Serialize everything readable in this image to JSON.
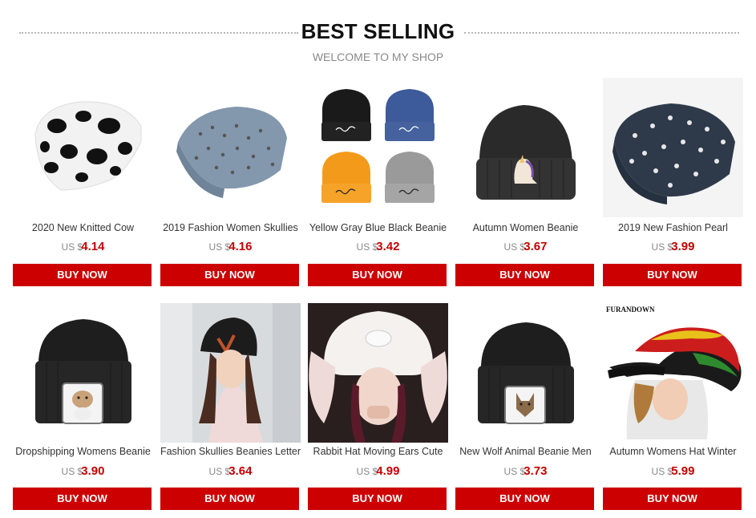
{
  "section": {
    "title": "BEST SELLING",
    "subtitle": "WELCOME TO MY SHOP"
  },
  "products": [
    {
      "name": "2020 New Knitted Cow",
      "currency": "US $",
      "price": "4.14",
      "button": "BUY NOW",
      "image": "cow-print-beanie"
    },
    {
      "name": "2019 Fashion Women Skullies",
      "currency": "US $",
      "price": "4.16",
      "button": "BUY NOW",
      "image": "studded-grey-beanie"
    },
    {
      "name": "Yellow Gray Blue Black Beanie",
      "currency": "US $",
      "price": "3.42",
      "button": "BUY NOW",
      "image": "four-color-beanies"
    },
    {
      "name": "Autumn Women Beanie",
      "currency": "US $",
      "price": "3.67",
      "button": "BUY NOW",
      "image": "black-unicorn-beanie"
    },
    {
      "name": "2019 New Fashion Pearl",
      "currency": "US $",
      "price": "3.99",
      "button": "BUY NOW",
      "image": "pearl-navy-beanie"
    },
    {
      "name": "Dropshipping Womens Beanie",
      "currency": "US $",
      "price": "3.90",
      "button": "BUY NOW",
      "image": "bulldog-patch-beanie"
    },
    {
      "name": "Fashion Skullies Beanies Letter",
      "currency": "US $",
      "price": "3.64",
      "button": "BUY NOW",
      "image": "letter-v-beanie-model"
    },
    {
      "name": "Rabbit Hat Moving Ears Cute",
      "currency": "US $",
      "price": "4.99",
      "button": "BUY NOW",
      "image": "rabbit-ears-hat-model"
    },
    {
      "name": "New Wolf Animal Beanie Men",
      "currency": "US $",
      "price": "3.73",
      "button": "BUY NOW",
      "image": "wolf-patch-beanie"
    },
    {
      "name": "Autumn Womens Hat Winter",
      "currency": "US $",
      "price": "5.99",
      "button": "BUY NOW",
      "image": "rasta-stripe-hat",
      "watermark": "FURANDOWN"
    }
  ],
  "colors": {
    "button": "#cc0000",
    "price": "#c40000"
  }
}
